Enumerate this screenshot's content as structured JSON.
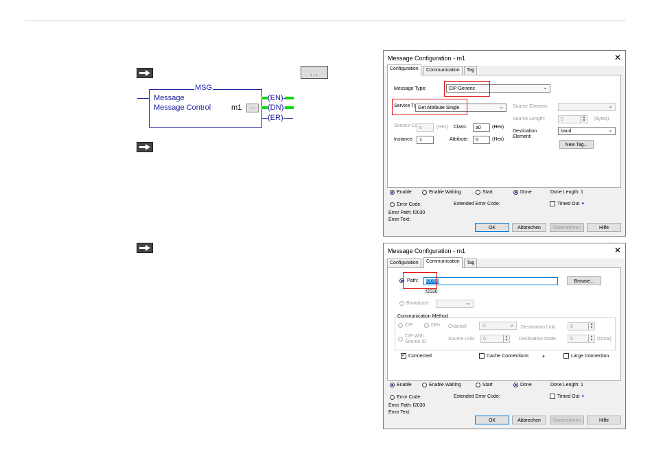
{
  "ladder": {
    "ellipsis": "...",
    "instr_title": "MSG",
    "message_label": "Message",
    "control_label": "Message Control",
    "control_value": "m1",
    "browse_dots": "...",
    "coil_en": "EN",
    "coil_dn": "DN",
    "coil_er": "ER"
  },
  "dialog1": {
    "title": "Message Configuration - m1",
    "close": "✕",
    "tabs": [
      "Configuration",
      "Communication",
      "Tag"
    ],
    "message_type_label": "Message Type:",
    "message_type_value": "CIP Generic",
    "service_type_label": "Service Type:",
    "service_type_value": "Get Attribute Single",
    "service_code_label": "Service Code:",
    "service_code_value": "e",
    "hex1": "(Hex)",
    "class_label": "Class:",
    "class_value": "a0",
    "hex2": "(Hex)",
    "instance_label": "Instance:",
    "instance_value": "1",
    "attribute_label": "Attribute:",
    "attribute_value": "0",
    "hex3": "(Hex)",
    "source_element_label": "Source Element:",
    "source_length_label": "Source Length:",
    "source_length_value": "0",
    "bytes_label": "(Bytes)",
    "dest_label": "Destination Element:",
    "dest_value": "baud",
    "new_tag": "New Tag..."
  },
  "dialog2": {
    "title": "Message Configuration - m1",
    "close": "✕",
    "tabs": [
      "Configuration",
      "Communication",
      "Tag"
    ],
    "path_label": "Path:",
    "path_value": "f2030",
    "path_resolved": "f2030",
    "browse": "Browse...",
    "broadcast_label": "Broadcast:",
    "comm_method": "Communication Method",
    "cip": "CIP",
    "dhplus": "DH+",
    "channel_label": "Channel:",
    "channel_value": "'A'",
    "dest_link_label": "Destination Link:",
    "dest_link_value": "0",
    "cip_source": "CIP With Source ID",
    "source_link_label": "Source Link:",
    "source_link_value": "0",
    "dest_node_label": "Destination Node:",
    "dest_node_value": "0",
    "octal": "(Octal)",
    "connected": "Connected",
    "cache": "Cache Connections",
    "large": "Large Connection"
  },
  "status": {
    "enable": "Enable",
    "enable_waiting": "Enable Waiting",
    "start": "Start",
    "done": "Done",
    "done_length": "Done Length: 1",
    "error_code": "Error Code:",
    "ext_error": "Extended Error Code:",
    "timed_out": "Timed Out",
    "error_path": "Error Path: f2030",
    "error_text": "Error Text:",
    "ok": "OK",
    "cancel": "Abbrechen",
    "apply": "Übernehmen",
    "help": "Hilfe"
  },
  "colors": {
    "highlight": "#e01010",
    "ladder_blue": "#2020a0",
    "energized": "#00dd00",
    "selection": "#0078d7"
  }
}
